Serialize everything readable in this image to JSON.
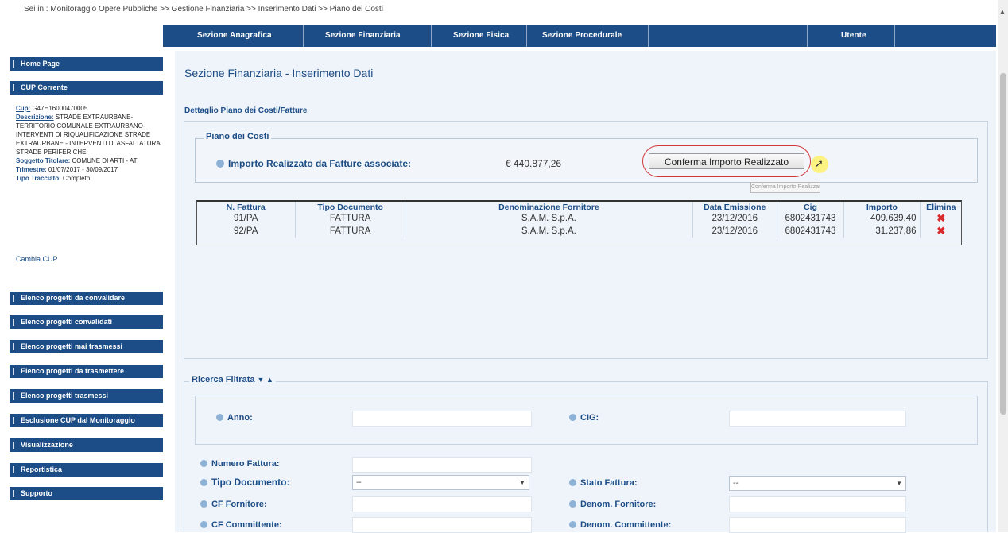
{
  "breadcrumb": "Sei in : Monitoraggio Opere Pubbliche >> Gestione Finanziaria >> Inserimento Dati >> Piano dei Costi",
  "topnav": {
    "tabs": [
      "Sezione Anagrafica",
      "Sezione Finanziaria",
      "Sezione Fisica",
      "Sezione Procedurale"
    ],
    "user": "Utente"
  },
  "sidebar": {
    "top_items": [
      "Home Page",
      "CUP Corrente"
    ],
    "cup_info": {
      "cup_label": "Cup:",
      "cup_value": "G47H16000470005",
      "desc_label": "Descrizione:",
      "desc_value": "STRADE EXTRAURBANE-TERRITORIO COMUNALE EXTRAURBANO-INTERVENTI DI RIQUALIFICAZIONE STRADE EXTRAURBANE - INTERVENTI DI ASFALTATURA STRADE PERIFERICHE",
      "sogg_label": "Soggetto Titolare:",
      "sogg_value": "COMUNE DI ARTI - AT",
      "trim_label": "Trimestre:",
      "trim_value": "01/07/2017 - 30/09/2017",
      "tipo_label": "Tipo Tracciato:",
      "tipo_value": "Completo"
    },
    "cambia_cup": "Cambia CUP",
    "menu_items": [
      "Elenco progetti da convalidare",
      "Elenco progetti convalidati",
      "Elenco progetti mai trasmessi",
      "Elenco progetti da trasmettere",
      "Elenco progetti trasmessi",
      "Esclusione CUP dal Monitoraggio",
      "Visualizzazione",
      "Reportistica",
      "Supporto"
    ]
  },
  "main": {
    "title": "Sezione Finanziaria - Inserimento Dati",
    "dettaglio_title": "Dettaglio Piano dei Costi/Fatture",
    "piano_legend": "Piano dei Costi",
    "importo_label": "Importo Realizzato da Fatture associate:",
    "importo_value": "€ 440.877,26",
    "conferma_button": "Conferma Importo Realizzato",
    "tooltip": "Conferma Importo Realizzato",
    "table": {
      "headers": [
        "N. Fattura",
        "Tipo Documento",
        "Denominazione Fornitore",
        "Data Emissione",
        "Cig",
        "Importo",
        "Elimina"
      ],
      "rows": [
        [
          "91/PA",
          "FATTURA",
          "S.A.M. S.p.A.",
          "23/12/2016",
          "6802431743",
          "409.639,40"
        ],
        [
          "92/PA",
          "FATTURA",
          "S.A.M. S.p.A.",
          "23/12/2016",
          "6802431743",
          "31.237,86"
        ]
      ]
    },
    "ricerca": {
      "legend": "Ricerca Filtrata",
      "toggles": "▼ ▲",
      "anno_label": "Anno:",
      "cig_label": "CIG:",
      "numero_label": "Numero Fattura:",
      "tipo_doc_label": "Tipo Documento:",
      "tipo_doc_value": "--",
      "stato_label": "Stato Fattura:",
      "stato_value": "--",
      "cf_fornitore_label": "CF Fornitore:",
      "denom_fornitore_label": "Denom. Fornitore:",
      "cf_committente_label": "CF Committente:",
      "denom_committente_label": "Denom. Committente:"
    }
  }
}
